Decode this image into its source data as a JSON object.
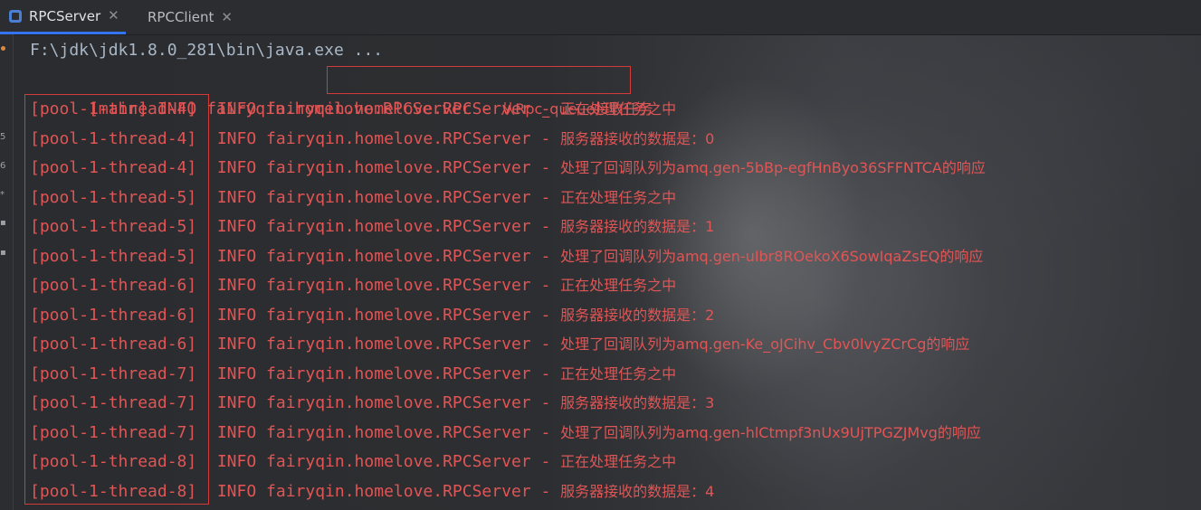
{
  "tabs": [
    {
      "label": "RPCServer",
      "active": true
    },
    {
      "label": "RPCClient",
      "active": false
    }
  ],
  "gutter": {
    "marks": [
      "5",
      "6",
      "*",
      "▪",
      "▪"
    ]
  },
  "console": {
    "command": "F:\\jdk\\jdk1.8.0_281\\bin\\java.exe ...",
    "lines": [
      {
        "thread": "[main]",
        "rest": " INFO fairyqin.homelove.",
        "ident": "RPCServer",
        "msg_pre": " - ",
        "msg_cn": "从Rpc_queue接收任务"
      },
      {
        "thread": "[pool-1-thread-4]",
        "rest": " INFO fairyqin.homelove.RPCServer - ",
        "msg": "正在处理任务之中"
      },
      {
        "thread": "[pool-1-thread-4]",
        "rest": " INFO fairyqin.homelove.RPCServer - ",
        "msg": "服务器接收的数据是：0"
      },
      {
        "thread": "[pool-1-thread-4]",
        "rest": " INFO fairyqin.homelove.RPCServer - ",
        "msg": "处理了回调队列为amq.gen-5bBp-egfHnByo36SFFNTCA的响应"
      },
      {
        "thread": "[pool-1-thread-5]",
        "rest": " INFO fairyqin.homelove.RPCServer - ",
        "msg": "正在处理任务之中"
      },
      {
        "thread": "[pool-1-thread-5]",
        "rest": " INFO fairyqin.homelove.RPCServer - ",
        "msg": "服务器接收的数据是：1"
      },
      {
        "thread": "[pool-1-thread-5]",
        "rest": " INFO fairyqin.homelove.RPCServer - ",
        "msg": "处理了回调队列为amq.gen-uIbr8ROekoX6SowIqaZsEQ的响应"
      },
      {
        "thread": "[pool-1-thread-6]",
        "rest": " INFO fairyqin.homelove.RPCServer - ",
        "msg": "正在处理任务之中"
      },
      {
        "thread": "[pool-1-thread-6]",
        "rest": " INFO fairyqin.homelove.RPCServer - ",
        "msg": "服务器接收的数据是：2"
      },
      {
        "thread": "[pool-1-thread-6]",
        "rest": " INFO fairyqin.homelove.RPCServer - ",
        "msg": "处理了回调队列为amq.gen-Ke_oJCihv_Cbv0lvyZCrCg的响应"
      },
      {
        "thread": "[pool-1-thread-7]",
        "rest": " INFO fairyqin.homelove.RPCServer - ",
        "msg": "正在处理任务之中"
      },
      {
        "thread": "[pool-1-thread-7]",
        "rest": " INFO fairyqin.homelove.RPCServer - ",
        "msg": "服务器接收的数据是：3"
      },
      {
        "thread": "[pool-1-thread-7]",
        "rest": " INFO fairyqin.homelove.RPCServer - ",
        "msg": "处理了回调队列为amq.gen-hlCtmpf3nUx9UjTPGZJMvg的响应"
      },
      {
        "thread": "[pool-1-thread-8]",
        "rest": " INFO fairyqin.homelove.RPCServer - ",
        "msg": "正在处理任务之中"
      },
      {
        "thread": "[pool-1-thread-8]",
        "rest": " INFO fairyqin.homelove.RPCServer - ",
        "msg": "服务器接收的数据是：4"
      }
    ]
  },
  "colors": {
    "log_text": "#e05555",
    "command_text": "#a9b7c6",
    "highlight_box": "#d33a3a",
    "active_tab_underline": "#3574f0"
  }
}
